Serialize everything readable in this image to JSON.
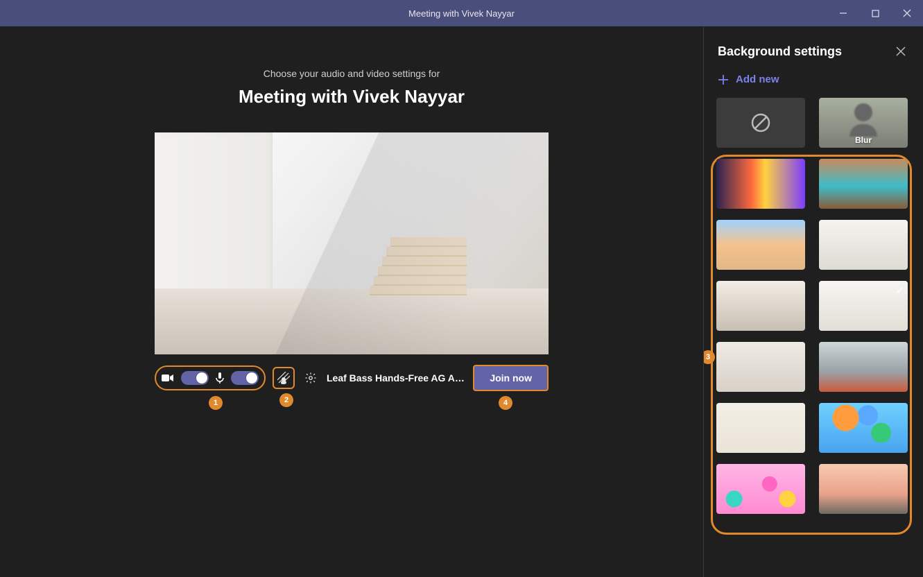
{
  "window": {
    "title": "Meeting with Vivek Nayyar"
  },
  "main": {
    "subheading": "Choose your audio and video settings for",
    "heading": "Meeting with Vivek Nayyar",
    "toggles": {
      "camera_on": true,
      "mic_on": true
    },
    "audio_device_label": "Leaf Bass Hands-Free AG Au…",
    "join_label": "Join now",
    "annotations": {
      "toggles_badge": "1",
      "bg_button_badge": "2",
      "bg_list_badge": "3",
      "join_badge": "4"
    }
  },
  "side": {
    "title": "Background settings",
    "add_new_label": "Add new",
    "blur_label": "Blur",
    "items": [
      {
        "id": "none",
        "kind": "none"
      },
      {
        "id": "blur",
        "kind": "blur"
      },
      {
        "id": "bg1",
        "kind": "image",
        "css": "linear-gradient(90deg,#2b2350,#ff6a3d 40%,#ffd23f 55%,#7a3dff)"
      },
      {
        "id": "bg2",
        "kind": "image",
        "css": "linear-gradient(180deg,#c98a5d 0%,#3fbcc8 55%,#8a5a3a 100%)"
      },
      {
        "id": "bg3",
        "kind": "image",
        "css": "linear-gradient(180deg,#9fd2ff 0%,#f5c28a 50%,#e2b788 100%)"
      },
      {
        "id": "bg4",
        "kind": "image",
        "css": "linear-gradient(180deg,#f6f3ee 0%,#dedbd5 100%)"
      },
      {
        "id": "bg5",
        "kind": "image",
        "css": "linear-gradient(180deg,#f2ede5 0%,#c8bfb3 100%)"
      },
      {
        "id": "bg6",
        "kind": "image",
        "css": "linear-gradient(180deg,#f7f5f2 0%,#e2ded7 100%)",
        "selected": true
      },
      {
        "id": "bg7",
        "kind": "image",
        "css": "linear-gradient(180deg,#efeae3 0%,#d7d1c8 100%)"
      },
      {
        "id": "bg8",
        "kind": "image",
        "css": "linear-gradient(180deg,#cfd6da 0%,#9aa1a6 60%,#c95b3e 100%)"
      },
      {
        "id": "bg9",
        "kind": "image",
        "css": "linear-gradient(180deg,#f4efe6 0%,#e9e3d8 100%)"
      },
      {
        "id": "bg10",
        "kind": "image",
        "css": "radial-gradient(circle at 30% 30%,#ff9d3e 0 18%,transparent 19%),radial-gradient(circle at 70% 60%,#35c978 0 14%,transparent 15%),radial-gradient(circle at 55% 25%,#5aa9ff 0 16%,transparent 17%),linear-gradient(180deg,#6fd1ff,#4aa3ef)"
      },
      {
        "id": "bg11",
        "kind": "image",
        "css": "radial-gradient(circle at 20% 70%,#39d6c4 0 10%,transparent 11%),radial-gradient(circle at 60% 40%,#ff66c4 0 12%,transparent 13%),radial-gradient(circle at 80% 70%,#ffd23f 0 10%,transparent 11%),linear-gradient(180deg,#ffb6e6,#ff8ad1)"
      },
      {
        "id": "bg12",
        "kind": "image",
        "css": "linear-gradient(180deg,#f7c9b0 0%,#e9a38a 60%,#6e6a62 100%)"
      }
    ]
  }
}
